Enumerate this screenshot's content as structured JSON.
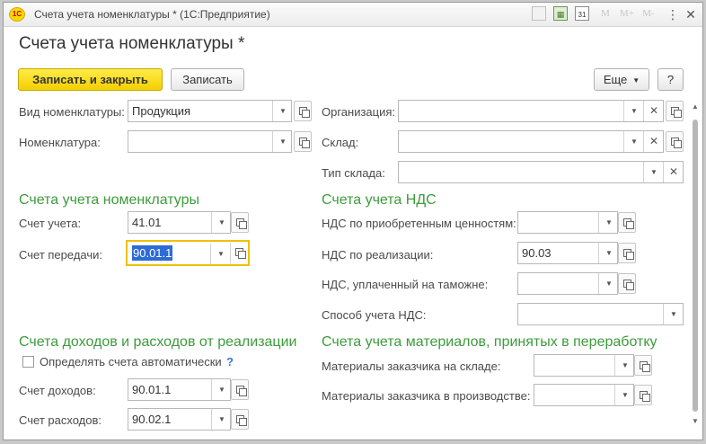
{
  "window": {
    "title": "Счета учета номенклатуры * (1С:Предприятие)",
    "logo": "1С",
    "icons": [
      "document-icon",
      "calculator-icon",
      "calendar-icon",
      "m-icon",
      "m-plus-icon",
      "m-minus-icon"
    ],
    "calendar_day": "31",
    "m_labels": [
      "M",
      "M+",
      "M-"
    ],
    "menu_glyph": "⋮",
    "close_glyph": "✕"
  },
  "form": {
    "title": "Счета учета номенклатуры *"
  },
  "toolbar": {
    "save_close_label": "Записать и закрыть",
    "save_label": "Записать",
    "more_label": "Еще",
    "help_label": "?"
  },
  "top_left": {
    "item_type_label": "Вид номенклатуры:",
    "item_type_value": "Продукция",
    "item_label": "Номенклатура:",
    "item_value": ""
  },
  "top_right": {
    "org_label": "Организация:",
    "org_value": "",
    "warehouse_label": "Склад:",
    "warehouse_value": "",
    "warehouse_type_label": "Тип склада:",
    "warehouse_type_value": ""
  },
  "item_accounts": {
    "header": "Счета учета номенклатуры",
    "account_label": "Счет учета:",
    "account_value": "41.01",
    "transfer_label": "Счет передачи:",
    "transfer_value": "90.01.1"
  },
  "vat_accounts": {
    "header": "Счета учета НДС",
    "purchased_label": "НДС по приобретенным ценностям:",
    "purchased_value": "",
    "sales_label": "НДС по реализации:",
    "sales_value": "90.03",
    "customs_label": "НДС, уплаченный на таможне:",
    "customs_value": "",
    "method_label": "Способ учета НДС:",
    "method_value": ""
  },
  "income_expense": {
    "header": "Счета доходов и расходов от реализации",
    "auto_label": "Определять счета автоматически",
    "auto_checked": false,
    "help": "?",
    "income_label": "Счет доходов:",
    "income_value": "90.01.1",
    "expense_label": "Счет расходов:",
    "expense_value": "90.02.1"
  },
  "materials": {
    "header": "Счета учета материалов, принятых в переработку",
    "warehouse_label": "Материалы заказчика на складе:",
    "warehouse_value": "",
    "production_label": "Материалы заказчика в производстве:",
    "production_value": ""
  },
  "glyphs": {
    "dropdown": "▼",
    "clear": "✕",
    "scroll_up": "▲",
    "scroll_down": "▼"
  }
}
